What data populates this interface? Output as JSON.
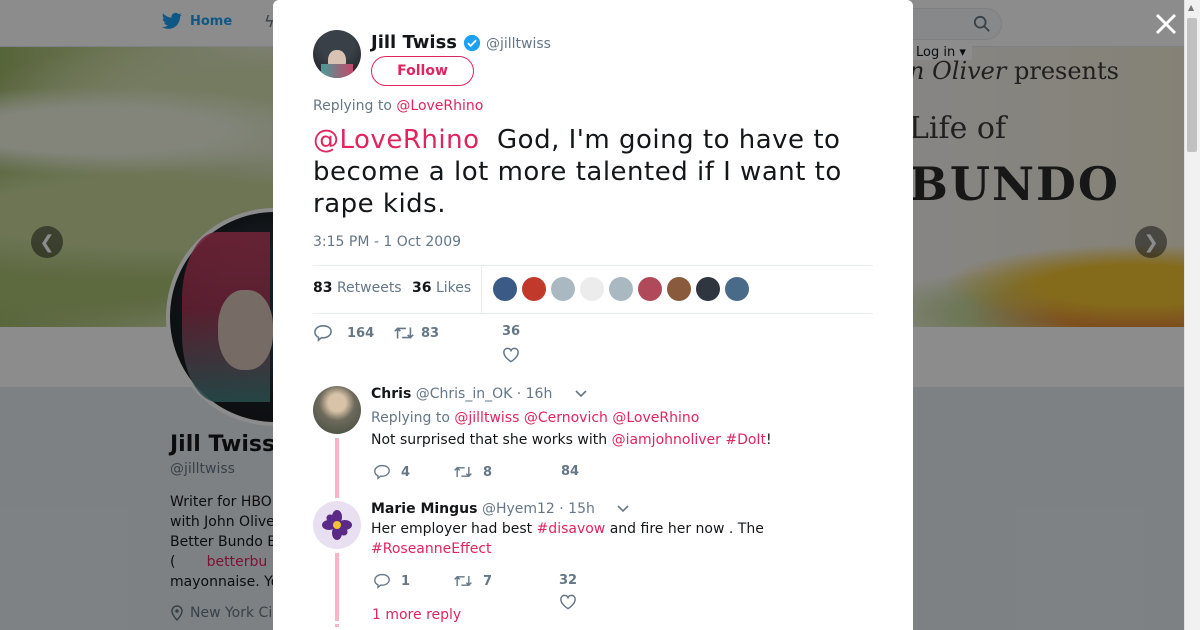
{
  "nav": {
    "home_label": "Home",
    "login_label": "Log in"
  },
  "banner": {
    "line1_name": "n Oliver",
    "line1_rest": "presents",
    "line2": "Life of",
    "line3": "BUNDO"
  },
  "background_profile": {
    "name": "Jill Twiss",
    "handle": "@jilltwiss",
    "bio_lines": [
      "Writer for HBO",
      "with John Olive",
      "Better Bundo B",
      "mayonnaise. Yo"
    ],
    "bio_link_prefix": "(",
    "bio_link": "betterbu",
    "location": "New York Ci"
  },
  "modal": {
    "author": {
      "name": "Jill Twiss",
      "handle": "@jilltwiss",
      "follow_label": "Follow"
    },
    "replying_prefix": "Replying to",
    "replying_to": "@LoveRhino",
    "tweet": {
      "mention": "@LoveRhino",
      "text": "God, I'm going to have to become a lot more talented if I want to rape kids.",
      "time": "3:15 PM - 1 Oct 2009"
    },
    "stats": {
      "retweets_count": "83",
      "retweets_label": "Retweets",
      "likes_count": "36",
      "likes_label": "Likes"
    },
    "liker_colors": [
      "#3b5b86",
      "#c0392b",
      "#aab8c2",
      "#ececec",
      "#aab8c2",
      "#b04a5a",
      "#8a5a3c",
      "#2f3640",
      "#4a6a8a"
    ],
    "actions": {
      "replies": "164",
      "retweets": "83",
      "likes": "36"
    },
    "replies": [
      {
        "name": "Chris",
        "handle": "@Chris_in_OK",
        "time": "· 16h",
        "replying_prefix": "Replying to",
        "replying_to": [
          "@jilltwiss",
          "@Cernovich",
          "@LoveRhino"
        ],
        "text_before": "Not surprised that she works with",
        "mention1": "@iamjohnoliver",
        "mention2": "#DoIt",
        "text_after": "!",
        "reply_count": "4",
        "retweet_count": "8",
        "like_count": "84"
      },
      {
        "name": "Marie Mingus",
        "handle": "@Hyem12",
        "time": "· 15h",
        "text_before": "Her employer had best",
        "hashtag1": "#disavow",
        "text_mid": "and fire her now . The",
        "hashtag2": "#RoseanneEffect",
        "reply_count": "1",
        "retweet_count": "7",
        "like_count": "32"
      }
    ],
    "more_replies": "1 more reply"
  }
}
